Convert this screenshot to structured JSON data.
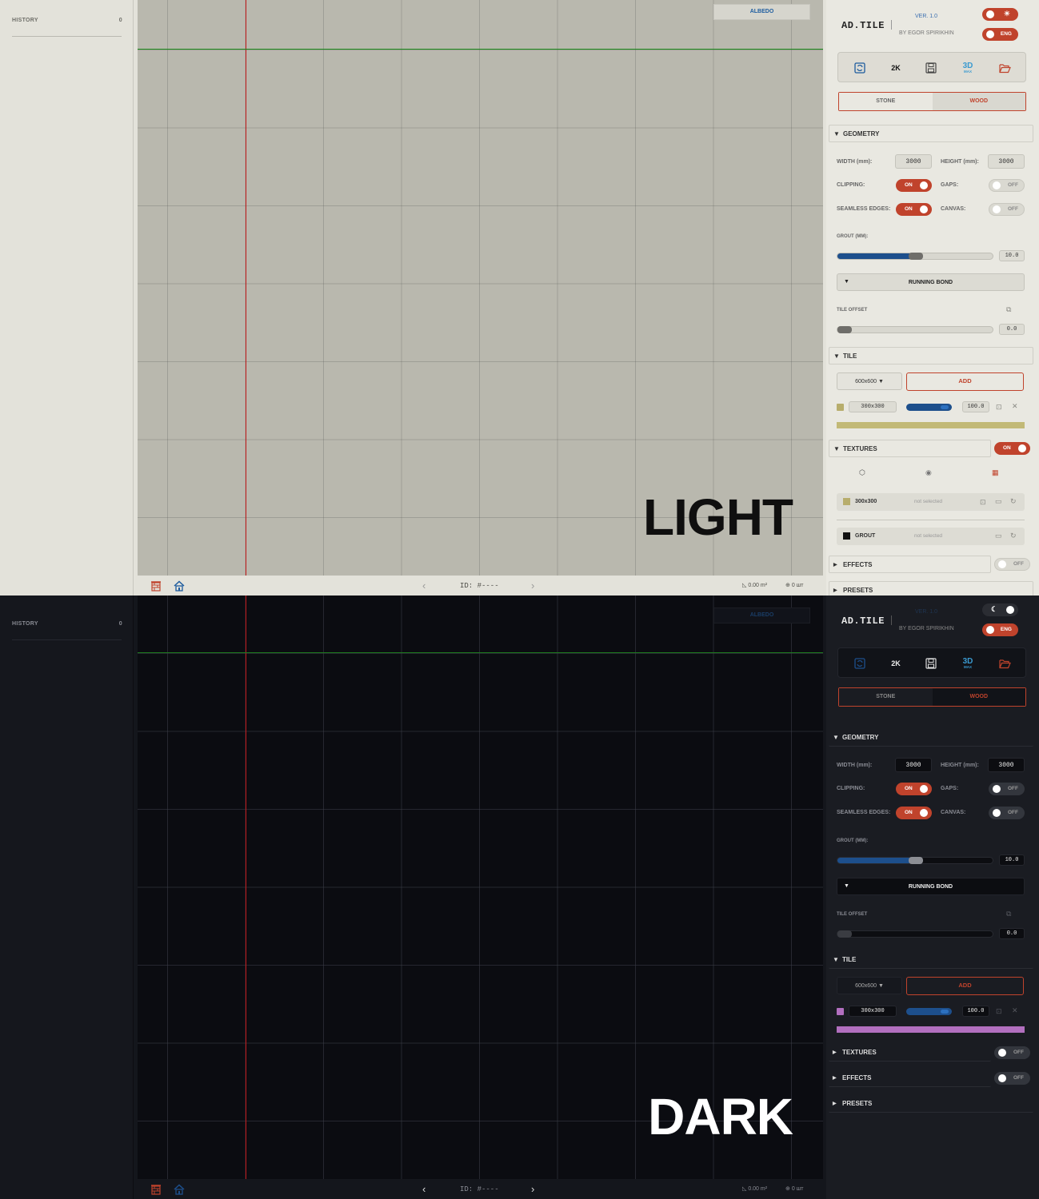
{
  "history": {
    "label": "HISTORY",
    "count": "0"
  },
  "canvas": {
    "channel": "ALBEDO"
  },
  "themes": {
    "light": "LIGHT",
    "dark": "DARK"
  },
  "statusbar": {
    "id": "ID: #----",
    "area": "0.00 m²",
    "qty": "0 шт"
  },
  "app": {
    "name": "AD.TILE",
    "version": "VER. 1.0",
    "author": "BY EGOR SPIRIKHIN",
    "lang": "ENG",
    "theme_light_glyph": "☀",
    "theme_dark_glyph": "☾"
  },
  "toolbar": {
    "res": "2K",
    "max_top": "3D",
    "max_sub": "MAX"
  },
  "material": {
    "stone": "STONE",
    "wood": "WOOD"
  },
  "geometry": {
    "title": "GEOMETRY",
    "width_label": "WIDTH (mm):",
    "width": "3000",
    "height_label": "HEIGHT (mm):",
    "height": "3000",
    "clipping_label": "CLIPPING:",
    "gaps_label": "GAPS:",
    "seamless_label": "SEAMLESS EDGES:",
    "canvas_label": "CANVAS:",
    "on": "ON",
    "off": "OFF",
    "grout_label": "GROUT (MM):",
    "grout": "10.0",
    "grout_fraction": 0.5,
    "pattern": "RUNNING BOND",
    "offset_label": "TILE OFFSET",
    "offset": "0.0",
    "offset_fraction": 0.0
  },
  "tile": {
    "title": "TILE",
    "size": "600x600",
    "add": "ADD",
    "item_size": "300x300",
    "item_value": "100.0"
  },
  "textures": {
    "title": "TEXTURES",
    "tile_name": "300x300",
    "grout_name": "GROUT",
    "not_selected": "not selected"
  },
  "effects": {
    "title": "EFFECTS"
  },
  "presets": {
    "title": "PRESETS"
  },
  "colors": {
    "accent": "#c0432c",
    "blue": "#1d4f8c",
    "swatch_light": "#b7ad6c",
    "swatch_dark": "#b26fbf"
  }
}
